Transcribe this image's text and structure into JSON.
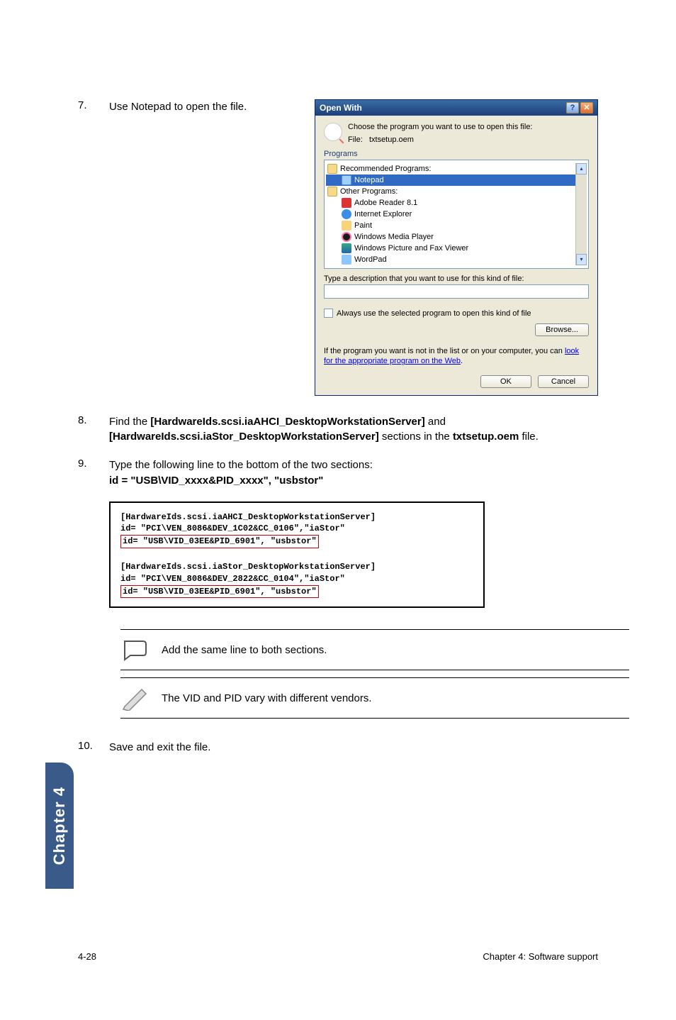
{
  "steps": {
    "s7": {
      "num": "7.",
      "text": "Use Notepad to open the file."
    },
    "s8": {
      "num": "8.",
      "prefix": "Find the ",
      "b1": "[HardwareIds.scsi.iaAHCI_DesktopWorkstationServer]",
      "mid": " and ",
      "b2": "[HardwareIds.scsi.iaStor_DesktopWorkstationServer]",
      "mid2": " sections in the ",
      "b3": "txtsetup.oem",
      "suffix": " file."
    },
    "s9": {
      "num": "9.",
      "line1": "Type the following line to the bottom of the two sections:",
      "line2": "id = \"USB\\VID_xxxx&PID_xxxx\", \"usbstor\""
    },
    "s10": {
      "num": "10.",
      "text": "Save and exit the file."
    }
  },
  "dialog": {
    "title": "Open With",
    "choose_text": "Choose the program you want to use to open this file:",
    "file_label": "File:",
    "file_name": "txtsetup.oem",
    "programs_label": "Programs",
    "rec": "Recommended Programs:",
    "notepad": "Notepad",
    "other": "Other Programs:",
    "p1": "Adobe Reader 8.1",
    "p2": "Internet Explorer",
    "p3": "Paint",
    "p4": "Windows Media Player",
    "p5": "Windows Picture and Fax Viewer",
    "p6": "WordPad",
    "desc_label": "Type a description that you want to use for this kind of file:",
    "chk_label": "Always use the selected program to open this kind of file",
    "browse": "Browse...",
    "note_pre": "If the program you want is not in the list or on your computer, you can ",
    "note_link": "look for the appropriate program on the Web",
    "note_post": ".",
    "ok": "OK",
    "cancel": "Cancel"
  },
  "code": {
    "l1": "[HardwareIds.scsi.iaAHCI_DesktopWorkstationServer]",
    "l2": "id= \"PCI\\VEN_8086&DEV_1C02&CC_0106\",\"iaStor\"",
    "l3": "id= \"USB\\VID_03EE&PID_6901\", \"usbstor\"",
    "l4": "[HardwareIds.scsi.iaStor_DesktopWorkstationServer]",
    "l5": "id= \"PCI\\VEN_8086&DEV_2822&CC_0104\",\"iaStor\"",
    "l6": "id= \"USB\\VID_03EE&PID_6901\", \"usbstor\""
  },
  "notes": {
    "n1": "Add the same line to both sections.",
    "n2": "The VID and PID vary with different vendors."
  },
  "sidebar": "Chapter 4",
  "footer": {
    "left": "4-28",
    "right": "Chapter 4: Software support"
  }
}
